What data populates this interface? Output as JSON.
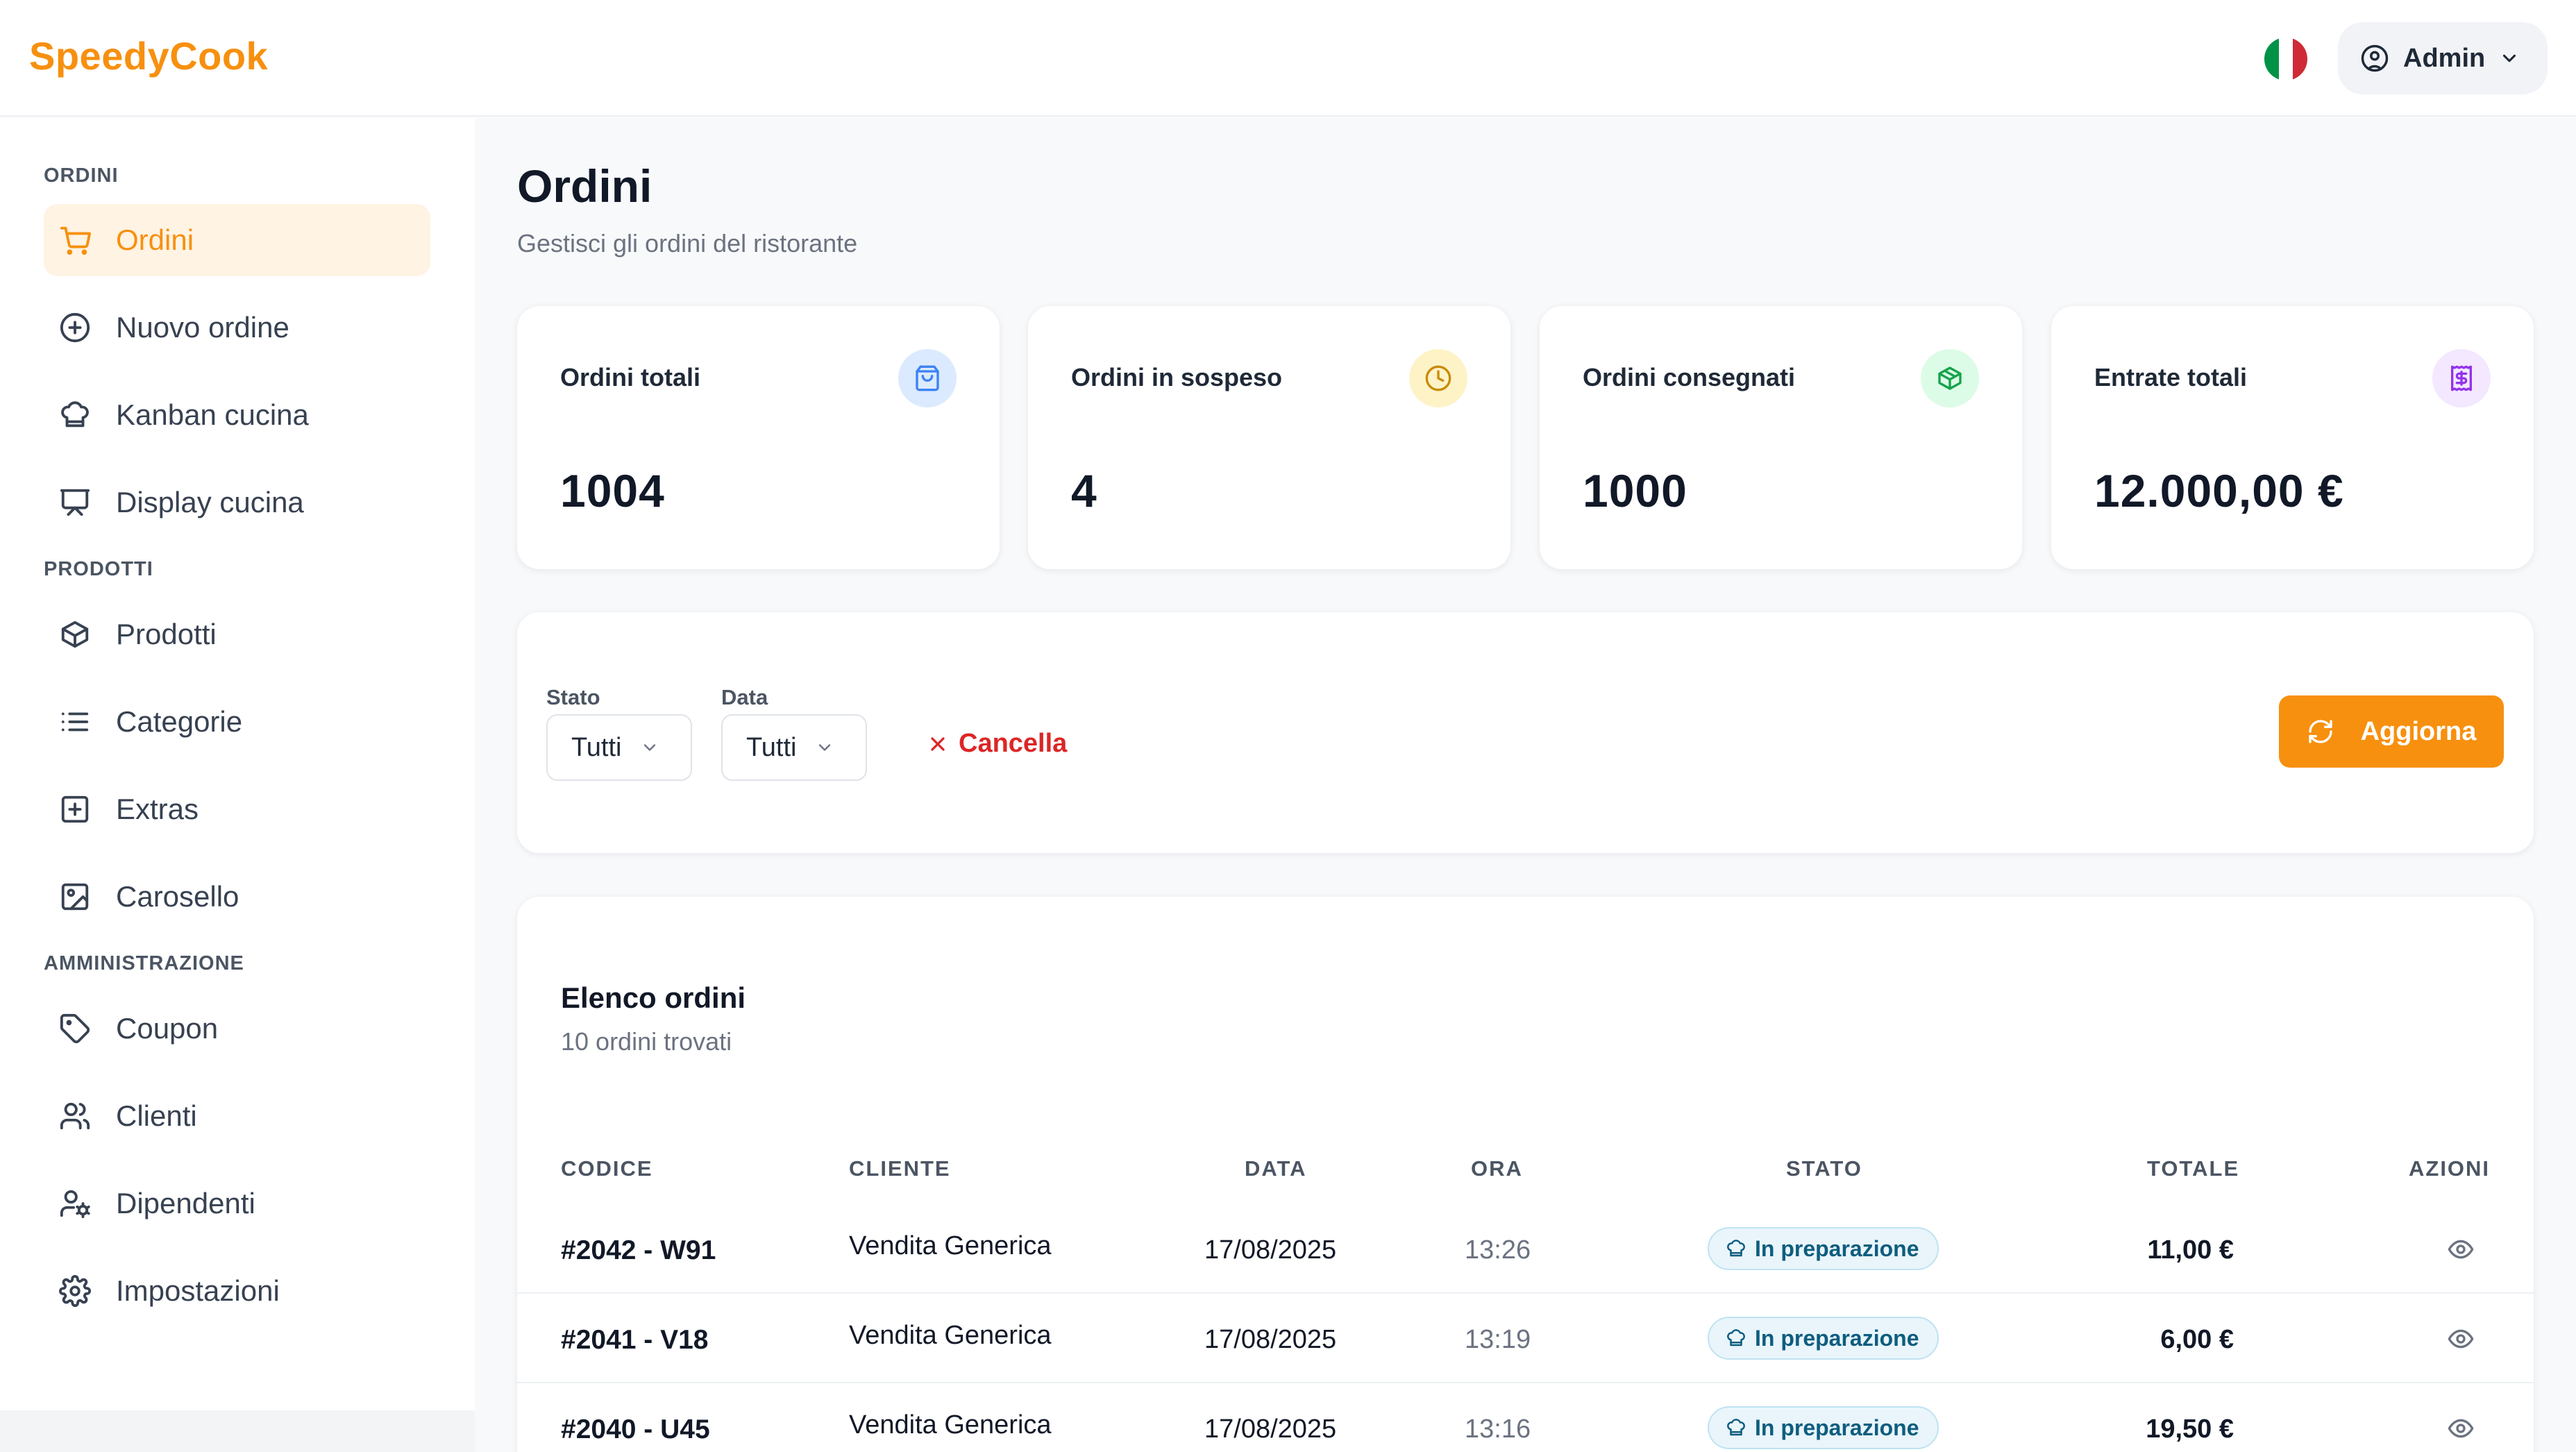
{
  "header": {
    "logo": "SpeedyCook",
    "flag": {
      "name": "italian-flag",
      "colors": [
        "#009246",
        "#ffffff",
        "#ce2b37"
      ]
    },
    "user_label": "Admin"
  },
  "sidebar": {
    "sections": [
      {
        "title": "ORDINI",
        "items": [
          {
            "label": "Ordini",
            "icon": "cart-icon",
            "active": true
          },
          {
            "label": "Nuovo ordine",
            "icon": "plus-circle-icon"
          },
          {
            "label": "Kanban cucina",
            "icon": "chef-hat-icon"
          },
          {
            "label": "Display cucina",
            "icon": "presentation-icon"
          }
        ]
      },
      {
        "title": "PRODOTTI",
        "items": [
          {
            "label": "Prodotti",
            "icon": "box-icon"
          },
          {
            "label": "Categorie",
            "icon": "list-icon"
          },
          {
            "label": "Extras",
            "icon": "plus-square-icon"
          },
          {
            "label": "Carosello",
            "icon": "image-icon"
          }
        ]
      },
      {
        "title": "AMMINISTRAZIONE",
        "items": [
          {
            "label": "Coupon",
            "icon": "tag-icon"
          },
          {
            "label": "Clienti",
            "icon": "users-icon"
          },
          {
            "label": "Dipendenti",
            "icon": "user-cog-icon"
          },
          {
            "label": "Impostazioni",
            "icon": "gear-icon"
          }
        ]
      }
    ]
  },
  "page": {
    "title": "Ordini",
    "subtitle": "Gestisci gli ordini del ristorante"
  },
  "stats": [
    {
      "label": "Ordini totali",
      "value": "1004",
      "icon": "shopping-bag-icon",
      "color": "#3b82f6",
      "bg": "#dbeafe"
    },
    {
      "label": "Ordini in sospeso",
      "value": "4",
      "icon": "clock-icon",
      "color": "#ca8a04",
      "bg": "#fef3c7"
    },
    {
      "label": "Ordini consegnati",
      "value": "1000",
      "icon": "package-icon",
      "color": "#16a34a",
      "bg": "#dcfce7"
    },
    {
      "label": "Entrate totali",
      "value": "12.000,00 €",
      "icon": "receipt-icon",
      "color": "#9333ea",
      "bg": "#f3e8ff"
    }
  ],
  "filters": {
    "status_label": "Stato",
    "status_value": "Tutti",
    "date_label": "Data",
    "date_value": "Tutti",
    "clear_label": "Cancella",
    "refresh_label": "Aggiorna"
  },
  "orders": {
    "title": "Elenco ordini",
    "count_text": "10 ordini trovati",
    "columns": [
      "CODICE",
      "CLIENTE",
      "DATA",
      "ORA",
      "STATO",
      "TOTALE",
      "AZIONI"
    ],
    "rows": [
      {
        "code": "#2042 - W91",
        "client": "Vendita Generica",
        "date": "17/08/2025",
        "time": "13:26",
        "status": "In preparazione",
        "total": "11,00 €"
      },
      {
        "code": "#2041 - V18",
        "client": "Vendita Generica",
        "date": "17/08/2025",
        "time": "13:19",
        "status": "In preparazione",
        "total": "6,00 €"
      },
      {
        "code": "#2040 - U45",
        "client": "Vendita Generica",
        "date": "17/08/2025",
        "time": "13:16",
        "status": "In preparazione",
        "total": "19,50 €"
      }
    ]
  },
  "colors": {
    "accent": "#f7900f",
    "danger": "#dc2626",
    "status_badge": "#0e5d7f"
  }
}
